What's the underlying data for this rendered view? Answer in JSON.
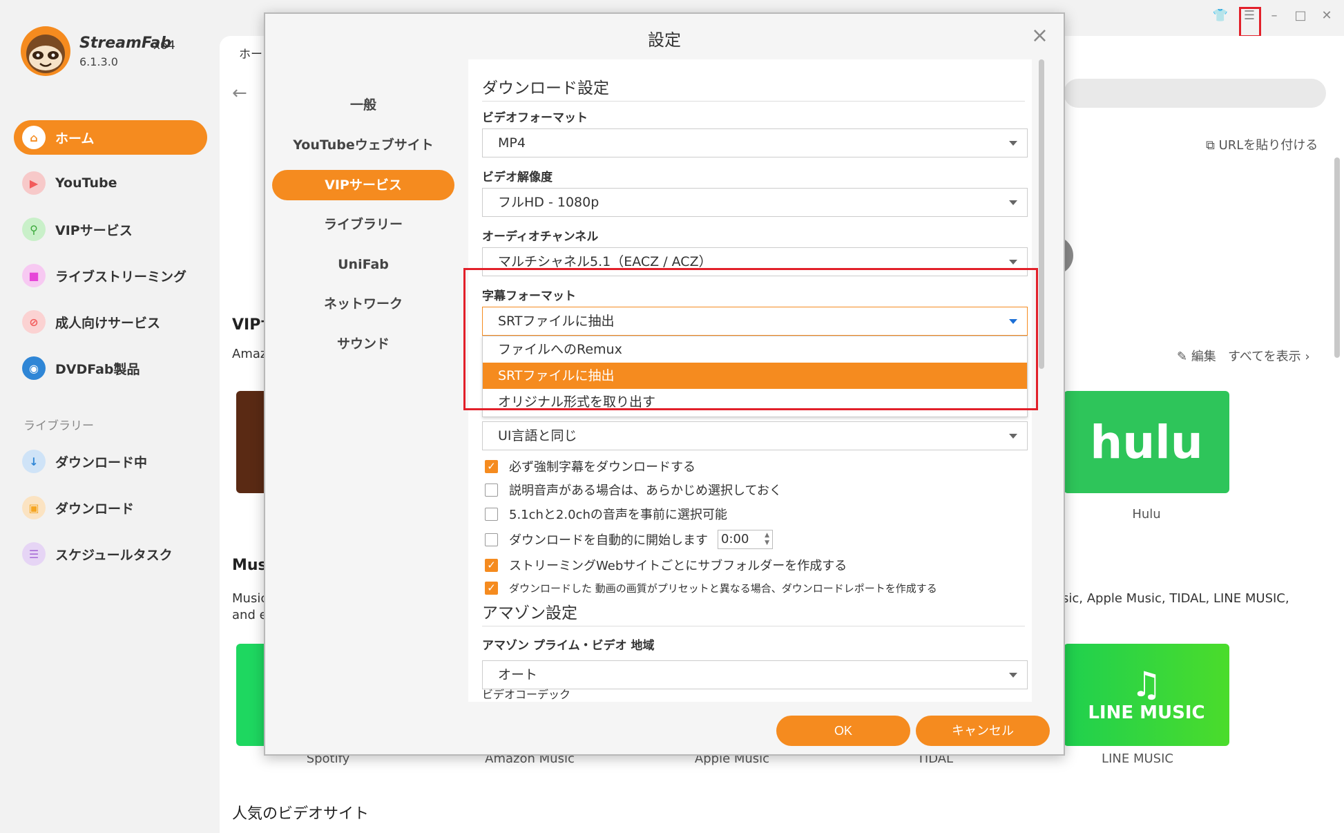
{
  "app": {
    "brand": "StreamFab",
    "arch": "x64",
    "version": "6.1.3.0"
  },
  "sidebar": {
    "items": [
      {
        "label": "ホーム",
        "icon": "home-icon",
        "color": "#f58b1f"
      },
      {
        "label": "YouTube",
        "icon": "youtube-icon",
        "color": "#f25b5b"
      },
      {
        "label": "VIPサービス",
        "icon": "key-icon",
        "color": "#4cc34c"
      },
      {
        "label": "ライブストリーミング",
        "icon": "camera-icon",
        "color": "#e646d8"
      },
      {
        "label": "成人向けサービス",
        "icon": "adult-icon",
        "color": "#f25b5b"
      },
      {
        "label": "DVDFab製品",
        "icon": "dvdfab-icon",
        "color": "#2f86d6"
      }
    ],
    "library_title": "ライブラリー",
    "library": [
      {
        "label": "ダウンロード中",
        "icon": "download-arrow-icon",
        "color": "#2f86d6"
      },
      {
        "label": "ダウンロード",
        "icon": "folder-icon",
        "color": "#f5a623"
      },
      {
        "label": "スケジュールタスク",
        "icon": "schedule-icon",
        "color": "#a86bd6"
      }
    ]
  },
  "main": {
    "tab": "ホー",
    "url_paste": "URLを貼り付ける",
    "vip_title": "VIPサ",
    "vip_sub": "Amaz",
    "edit": "編集",
    "show_all": "すべてを表示",
    "hulu_tile": "hulu",
    "hulu_label": "Hulu",
    "music_title": "Mus",
    "music_sub_left": "Music",
    "music_sub_left2": "and e",
    "music_sub_right": "sic, Apple Music, TIDAL, LINE MUSIC,",
    "line_music_tile": "LINE MUSIC",
    "line_music_label": "LINE MUSIC",
    "music_labels": [
      "Spotify",
      "Amazon Music",
      "Apple Music",
      "TIDAL"
    ],
    "popular": "人気のビデオサイト"
  },
  "dialog": {
    "title": "設定",
    "nav": [
      "一般",
      "YouTubeウェブサイト",
      "VIPサービス",
      "ライブラリー",
      "UniFab",
      "ネットワーク",
      "サウンド"
    ],
    "active_nav": "VIPサービス",
    "download_heading": "ダウンロード設定",
    "video_format_label": "ビデオフォーマット",
    "video_format": "MP4",
    "video_res_label": "ビデオ解像度",
    "video_res": "フルHD - 1080p",
    "audio_label": "オーディオチャンネル",
    "audio": "マルチシャネル5.1（EACZ / ACZ）",
    "subtitle_label": "字幕フォーマット",
    "subtitle": "SRTファイルに抽出",
    "subtitle_options": [
      "ファイルへのRemux",
      "SRTファイルに抽出",
      "オリジナル形式を取り出す"
    ],
    "ui_lang": "UI言語と同じ",
    "checks": [
      {
        "label": "必ず強制字幕をダウンロードする",
        "checked": true
      },
      {
        "label": "説明音声がある場合は、あらかじめ選択しておく",
        "checked": false
      },
      {
        "label": "5.1chと2.0chの音声を事前に選択可能",
        "checked": false
      },
      {
        "label": "ダウンロードを自動的に開始します",
        "checked": false
      },
      {
        "label": "ストリーミングWebサイトごとにサブフォルダーを作成する",
        "checked": true
      },
      {
        "label": "ダウンロードした 動画の画質がプリセットと異なる場合、ダウンロードレポートを作成する",
        "checked": true
      }
    ],
    "auto_time": "0:00",
    "amazon_heading": "アマゾン設定",
    "amazon_region_label": "アマゾン プライム・ビデオ 地域",
    "amazon_region": "オート",
    "video_codec_label": "ビデオコーデック",
    "ok": "OK",
    "cancel": "キャンセル"
  },
  "colors": {
    "accent": "#f58b1f",
    "highlight": "#e2202a"
  }
}
